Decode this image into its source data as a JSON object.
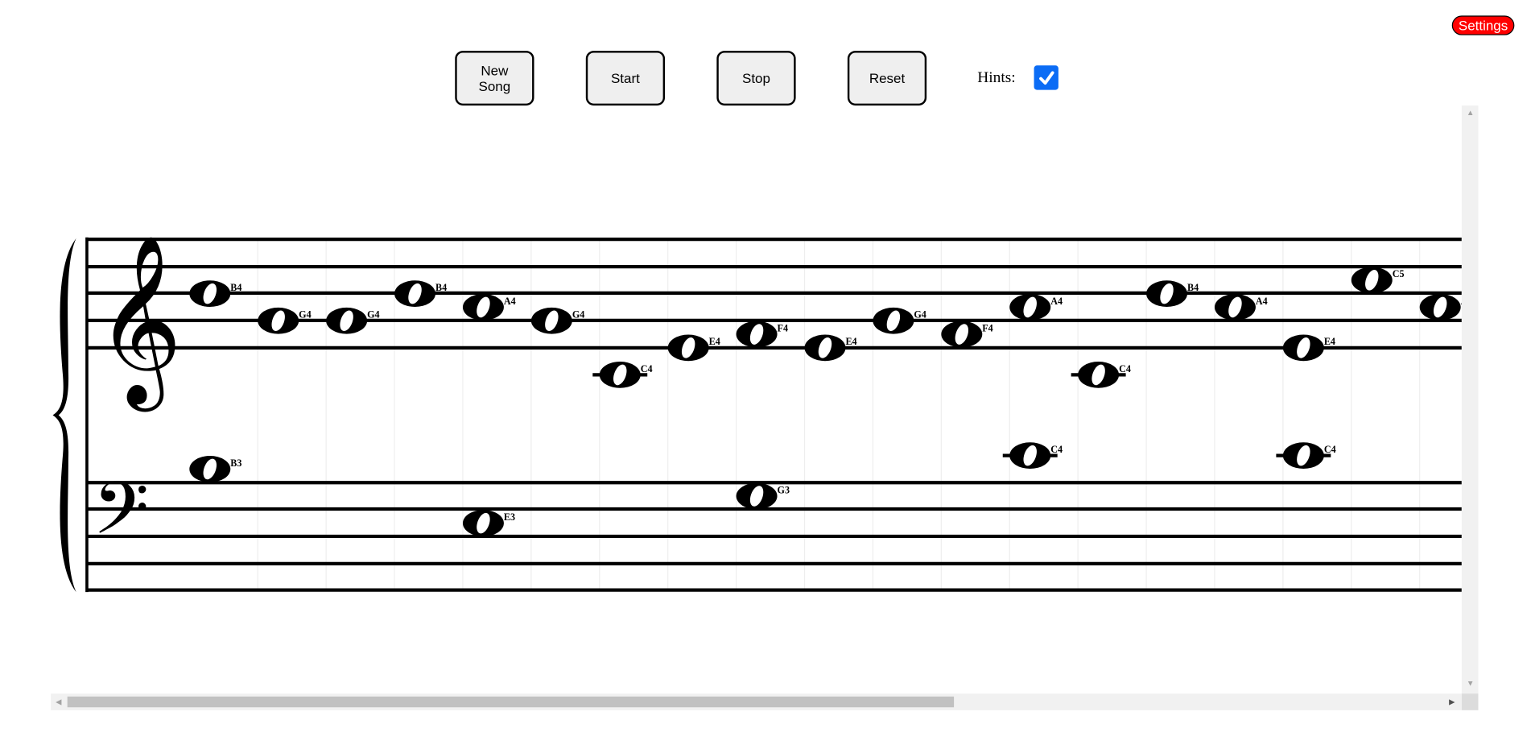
{
  "settings_label": "Settings",
  "toolbar": {
    "new_song_line1": "New",
    "new_song_line2": "Song",
    "start": "Start",
    "stop": "Stop",
    "reset": "Reset",
    "hints_label": "Hints:",
    "hints_checked": true,
    "hints_color": "#0b6cf5"
  },
  "score": {
    "clefs": [
      "treble",
      "bass"
    ],
    "treble_notes": [
      "B4",
      "G4",
      "G4",
      "B4",
      "A4",
      "G4",
      "C4",
      "E4",
      "F4",
      "E4",
      "G4",
      "F4",
      "A4",
      "C4",
      "B4",
      "A4",
      "E4",
      "C5",
      "A4"
    ],
    "bass_notes": [
      {
        "col": 0,
        "note": "B3"
      },
      {
        "col": 4,
        "note": "E3"
      },
      {
        "col": 8,
        "note": "G3"
      },
      {
        "col": 12,
        "note": "C4"
      },
      {
        "col": 16,
        "note": "C4"
      }
    ],
    "horizontal_scroll_fraction": 0.0
  }
}
